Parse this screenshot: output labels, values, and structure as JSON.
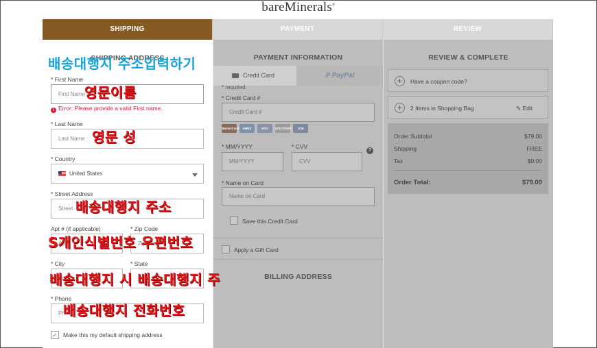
{
  "brand": {
    "logo_text": "bareMinerals",
    "logo_mark": "®"
  },
  "steps": [
    {
      "label": "SHIPPING",
      "active": true
    },
    {
      "label": "PAYMENT",
      "active": false
    },
    {
      "label": "REVIEW",
      "active": false
    }
  ],
  "shipping": {
    "section_title": "SHIPPING ADDRESS",
    "required_note": "* req",
    "first_name": {
      "label": "* First Name",
      "placeholder": "First Name",
      "error": "Error: Please provide a valid First name."
    },
    "last_name": {
      "label": "* Last Name",
      "placeholder": "Last Name"
    },
    "country": {
      "label": "* Country",
      "value": "United States"
    },
    "street": {
      "label": "* Street Address",
      "placeholder": "Street"
    },
    "apt": {
      "label": "Apt # (if applicable)",
      "placeholder": "Apt"
    },
    "zip": {
      "label": "* Zip Code",
      "placeholder": "Zip Code"
    },
    "city": {
      "label": "* City",
      "placeholder": "City"
    },
    "state": {
      "label": "* State",
      "placeholder": "St"
    },
    "phone": {
      "label": "* Phone",
      "placeholder": "Ph"
    },
    "default_checkbox": {
      "label": "Make this my default shipping address",
      "checked": true
    }
  },
  "payment": {
    "section_title": "PAYMENT INFORMATION",
    "tab_credit": "Credit Card",
    "tab_paypal": "PayPal",
    "required_note": "* required",
    "cc_number": {
      "label": "* Credit Card #",
      "placeholder": "Credit Card #"
    },
    "cards": [
      "MasterCard",
      "AMEX",
      "VISA",
      "DISCOVER",
      "JCB"
    ],
    "exp": {
      "label": "* MM/YYYY",
      "placeholder": "MM/YYYY"
    },
    "cvv": {
      "label": "* CVV",
      "placeholder": "CVV",
      "help": "?"
    },
    "name_on_card": {
      "label": "* Name on Card",
      "placeholder": "Name on Card"
    },
    "save_card": "Save this Credit Card",
    "gift_card": "Apply a Gift Card",
    "billing_title": "BILLING ADDRESS"
  },
  "review": {
    "section_title": "REVIEW & COMPLETE",
    "coupon": "Have a coupon code?",
    "bag": "2 Items in Shopping Bag",
    "edit": "Edit",
    "order_subtotal_label": "Order Subtotal",
    "order_subtotal": "$79.00",
    "shipping_label": "Shipping",
    "shipping_value": "FREE",
    "tax_label": "Tax",
    "tax_value": "$0.00",
    "total_label": "Order Total:",
    "total_value": "$79.00"
  },
  "annotations": {
    "title": "배송대행지 주소입력하기",
    "first_name": "영문이름",
    "last_name": "영문 성",
    "street": "배송대행지 주소",
    "apt_zip": "S개인식별번호  우편번호",
    "city_state": "배송대행지 시  배송대행지 주",
    "phone": "배송대행지 전화번호"
  },
  "colors": {
    "active_step": "#855a22",
    "error": "#d6213b",
    "annotation_red": "#e3161b",
    "annotation_blue": "#16a4d8"
  }
}
